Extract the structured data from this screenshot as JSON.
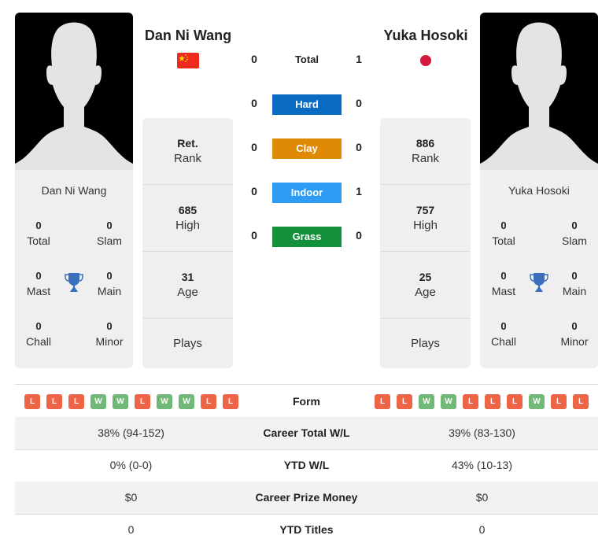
{
  "colors": {
    "hard": "#0a6bc2",
    "clay": "#df8a04",
    "indoor": "#2e9cf5",
    "grass": "#13903a",
    "win": "#72b879",
    "loss": "#ee6447",
    "trophy": "#3a6fbf"
  },
  "player1": {
    "name": "Dan Ni Wang",
    "flag": "china-flag",
    "titles": {
      "total": {
        "value": "0",
        "label": "Total"
      },
      "slam": {
        "value": "0",
        "label": "Slam"
      },
      "mast": {
        "value": "0",
        "label": "Mast"
      },
      "main": {
        "value": "0",
        "label": "Main"
      },
      "chall": {
        "value": "0",
        "label": "Chall"
      },
      "minor": {
        "value": "0",
        "label": "Minor"
      }
    },
    "stats": {
      "rank": {
        "value": "Ret.",
        "label": "Rank"
      },
      "high": {
        "value": "685",
        "label": "High"
      },
      "age": {
        "value": "31",
        "label": "Age"
      },
      "plays": {
        "value": "",
        "label": "Plays"
      }
    },
    "form": [
      "L",
      "L",
      "L",
      "W",
      "W",
      "L",
      "W",
      "W",
      "L",
      "L"
    ],
    "career_wl": "38% (94-152)",
    "ytd_wl": "0% (0-0)",
    "prize": "$0",
    "ytd_titles": "0"
  },
  "player2": {
    "name": "Yuka Hosoki",
    "flag": "japan-flag",
    "titles": {
      "total": {
        "value": "0",
        "label": "Total"
      },
      "slam": {
        "value": "0",
        "label": "Slam"
      },
      "mast": {
        "value": "0",
        "label": "Mast"
      },
      "main": {
        "value": "0",
        "label": "Main"
      },
      "chall": {
        "value": "0",
        "label": "Chall"
      },
      "minor": {
        "value": "0",
        "label": "Minor"
      }
    },
    "stats": {
      "rank": {
        "value": "886",
        "label": "Rank"
      },
      "high": {
        "value": "757",
        "label": "High"
      },
      "age": {
        "value": "25",
        "label": "Age"
      },
      "plays": {
        "value": "",
        "label": "Plays"
      }
    },
    "form": [
      "L",
      "L",
      "W",
      "W",
      "L",
      "L",
      "L",
      "W",
      "L",
      "L"
    ],
    "career_wl": "39% (83-130)",
    "ytd_wl": "43% (10-13)",
    "prize": "$0",
    "ytd_titles": "0"
  },
  "h2h": {
    "total": {
      "label": "Total",
      "left": "0",
      "right": "1"
    },
    "hard": {
      "label": "Hard",
      "left": "0",
      "right": "0"
    },
    "clay": {
      "label": "Clay",
      "left": "0",
      "right": "0"
    },
    "indoor": {
      "label": "Indoor",
      "left": "0",
      "right": "1"
    },
    "grass": {
      "label": "Grass",
      "left": "0",
      "right": "0"
    }
  },
  "table": {
    "form_label": "Form",
    "career_wl_label": "Career Total W/L",
    "ytd_wl_label": "YTD W/L",
    "prize_label": "Career Prize Money",
    "ytd_titles_label": "YTD Titles"
  }
}
